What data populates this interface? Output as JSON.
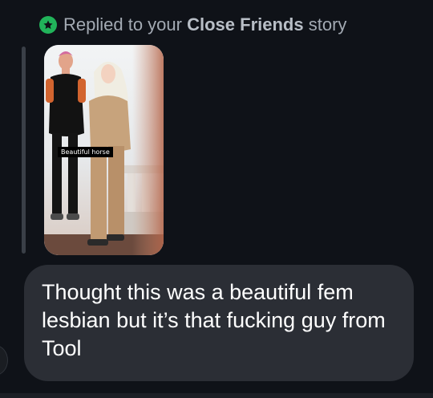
{
  "reply_header": {
    "prefix": "Replied to your",
    "audience": "Close Friends",
    "suffix": "story",
    "icon": "star-icon",
    "badge_color": "#21b35a"
  },
  "story": {
    "caption": "Beautiful horse"
  },
  "message": {
    "text": "Thought this was a beautiful fem lesbian but it’s that fucking guy from Tool"
  }
}
